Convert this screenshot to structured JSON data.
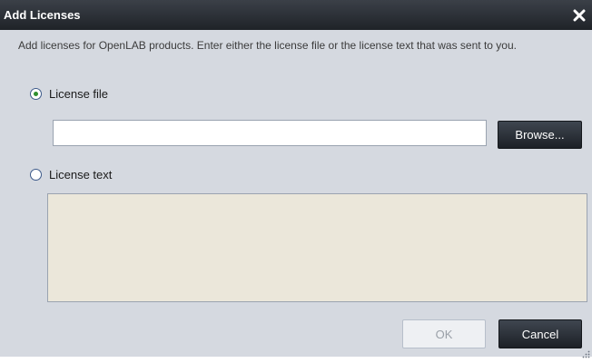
{
  "dialog": {
    "title": "Add Licenses",
    "intro": "Add licenses for OpenLAB products. Enter either the license file or the license text that was sent to you.",
    "options": {
      "license_file_label": "License file",
      "license_text_label": "License text",
      "selected": "license_file"
    },
    "license_file": {
      "value": "",
      "placeholder": ""
    },
    "license_text": {
      "value": ""
    },
    "buttons": {
      "browse": "Browse...",
      "ok": "OK",
      "cancel": "Cancel"
    }
  },
  "icons": {
    "close": "close-icon",
    "resize": "resize-grip-icon"
  },
  "colors": {
    "titlebar": "#1f2328",
    "dialog_background": "#d5d9e0",
    "text_area_background": "#ebe7da",
    "radio_selected": "#2f8f2f",
    "dark_button": "#1c2026"
  }
}
